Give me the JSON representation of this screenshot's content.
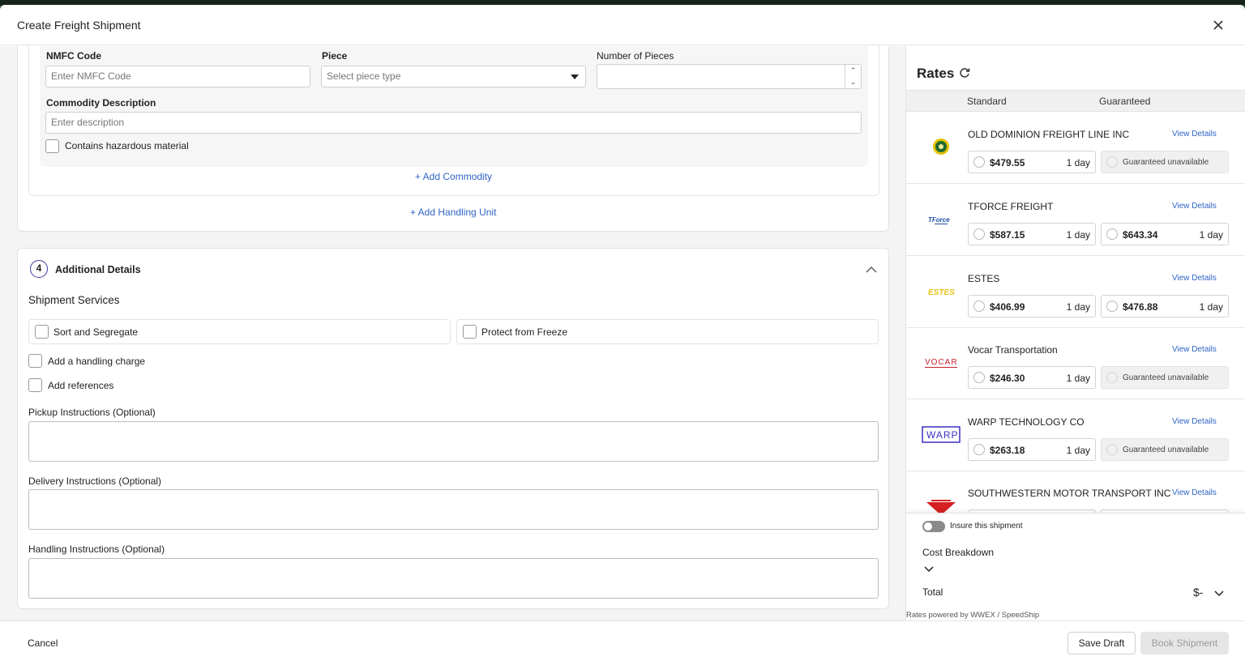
{
  "modal": {
    "title": "Create Freight Shipment"
  },
  "commodity": {
    "nmfc_label": "NMFC Code",
    "nmfc_placeholder": "Enter NMFC Code",
    "piece_label": "Piece",
    "piece_placeholder": "Select piece type",
    "pieces_label": "Number of Pieces",
    "pieces_value": "",
    "description_label": "Commodity Description",
    "description_placeholder": "Enter description",
    "hazardous_label": "Contains hazardous material",
    "add_commodity": "+ Add Commodity",
    "add_handling_unit": "+ Add Handling Unit"
  },
  "additional": {
    "step_number": "4",
    "title": "Additional Details",
    "services_title": "Shipment Services",
    "services": [
      "Sort and Segregate",
      "Protect from Freeze"
    ],
    "handling_charge_label": "Add a handling charge",
    "references_label": "Add references",
    "pickup_label": "Pickup Instructions (Optional)",
    "delivery_label": "Delivery Instructions (Optional)",
    "handling_instructions_label": "Handling Instructions (Optional)"
  },
  "rates": {
    "title": "Rates",
    "col_standard": "Standard",
    "col_guaranteed": "Guaranteed",
    "view_details": "View Details",
    "carriers": [
      {
        "name": "OLD DOMINION FREIGHT LINE INC",
        "logo": "old-dominion-logo",
        "standard_price": "$479.55",
        "standard_days": "1 day",
        "guaranteed_price": "",
        "guaranteed_days": "",
        "guaranteed_text": "Guaranteed unavailable"
      },
      {
        "name": "TFORCE FREIGHT",
        "logo": "tforce-logo",
        "standard_price": "$587.15",
        "standard_days": "1 day",
        "guaranteed_price": "$643.34",
        "guaranteed_days": "1 day",
        "guaranteed_text": ""
      },
      {
        "name": "ESTES",
        "logo": "estes-logo",
        "standard_price": "$406.99",
        "standard_days": "1 day",
        "guaranteed_price": "$476.88",
        "guaranteed_days": "1 day",
        "guaranteed_text": ""
      },
      {
        "name": "Vocar Transportation",
        "logo": "vocar-logo",
        "standard_price": "$246.30",
        "standard_days": "1 day",
        "guaranteed_price": "",
        "guaranteed_days": "",
        "guaranteed_text": "Guaranteed unavailable"
      },
      {
        "name": "WARP TECHNOLOGY CO",
        "logo": "warp-logo",
        "standard_price": "$263.18",
        "standard_days": "1 day",
        "guaranteed_price": "",
        "guaranteed_days": "",
        "guaranteed_text": "Guaranteed unavailable"
      },
      {
        "name": "SOUTHWESTERN MOTOR TRANSPORT INC",
        "logo": "smt-logo",
        "standard_price": "",
        "standard_days": "",
        "guaranteed_price": "",
        "guaranteed_days": "",
        "guaranteed_text": ""
      }
    ],
    "insure_label": "Insure this shipment",
    "cost_breakdown_label": "Cost Breakdown",
    "total_label": "Total",
    "total_value": "$-",
    "powered_by": "Rates powered by WWEX / SpeedShip"
  },
  "footer": {
    "cancel": "Cancel",
    "save_draft": "Save Draft",
    "book_shipment": "Book Shipment"
  },
  "colors": {
    "accent": "#2f64c4",
    "step_ring": "#3a3aa0",
    "disabled_button": "#e6e6e6"
  }
}
